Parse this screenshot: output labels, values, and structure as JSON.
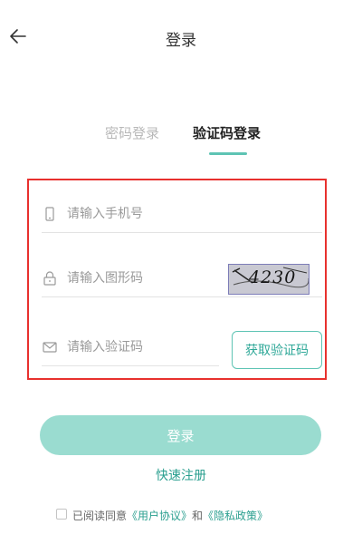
{
  "header": {
    "title": "登录",
    "back_icon": "arrow-left-icon"
  },
  "tabs": [
    {
      "label": "密码登录",
      "active": false
    },
    {
      "label": "验证码登录",
      "active": true
    }
  ],
  "form": {
    "phone": {
      "placeholder": "请输入手机号",
      "value": "",
      "icon": "phone-icon"
    },
    "image_code": {
      "placeholder": "请输入图形码",
      "value": "",
      "icon": "lock-icon",
      "captcha_text": "4230"
    },
    "sms_code": {
      "placeholder": "请输入验证码",
      "value": "",
      "icon": "mail-icon",
      "button_label": "获取验证码"
    }
  },
  "login_button": {
    "label": "登录"
  },
  "register_link": "快速注册",
  "agreement": {
    "checked": false,
    "prefix": "已阅读同意",
    "user_agreement": "《用户协议》",
    "connector": "和",
    "privacy_policy": "《隐私政策》"
  },
  "colors": {
    "accent": "#5ec4b4",
    "button_disabled": "#9adcd0",
    "highlight_border": "#e8312e",
    "link": "#2a9f8f"
  }
}
